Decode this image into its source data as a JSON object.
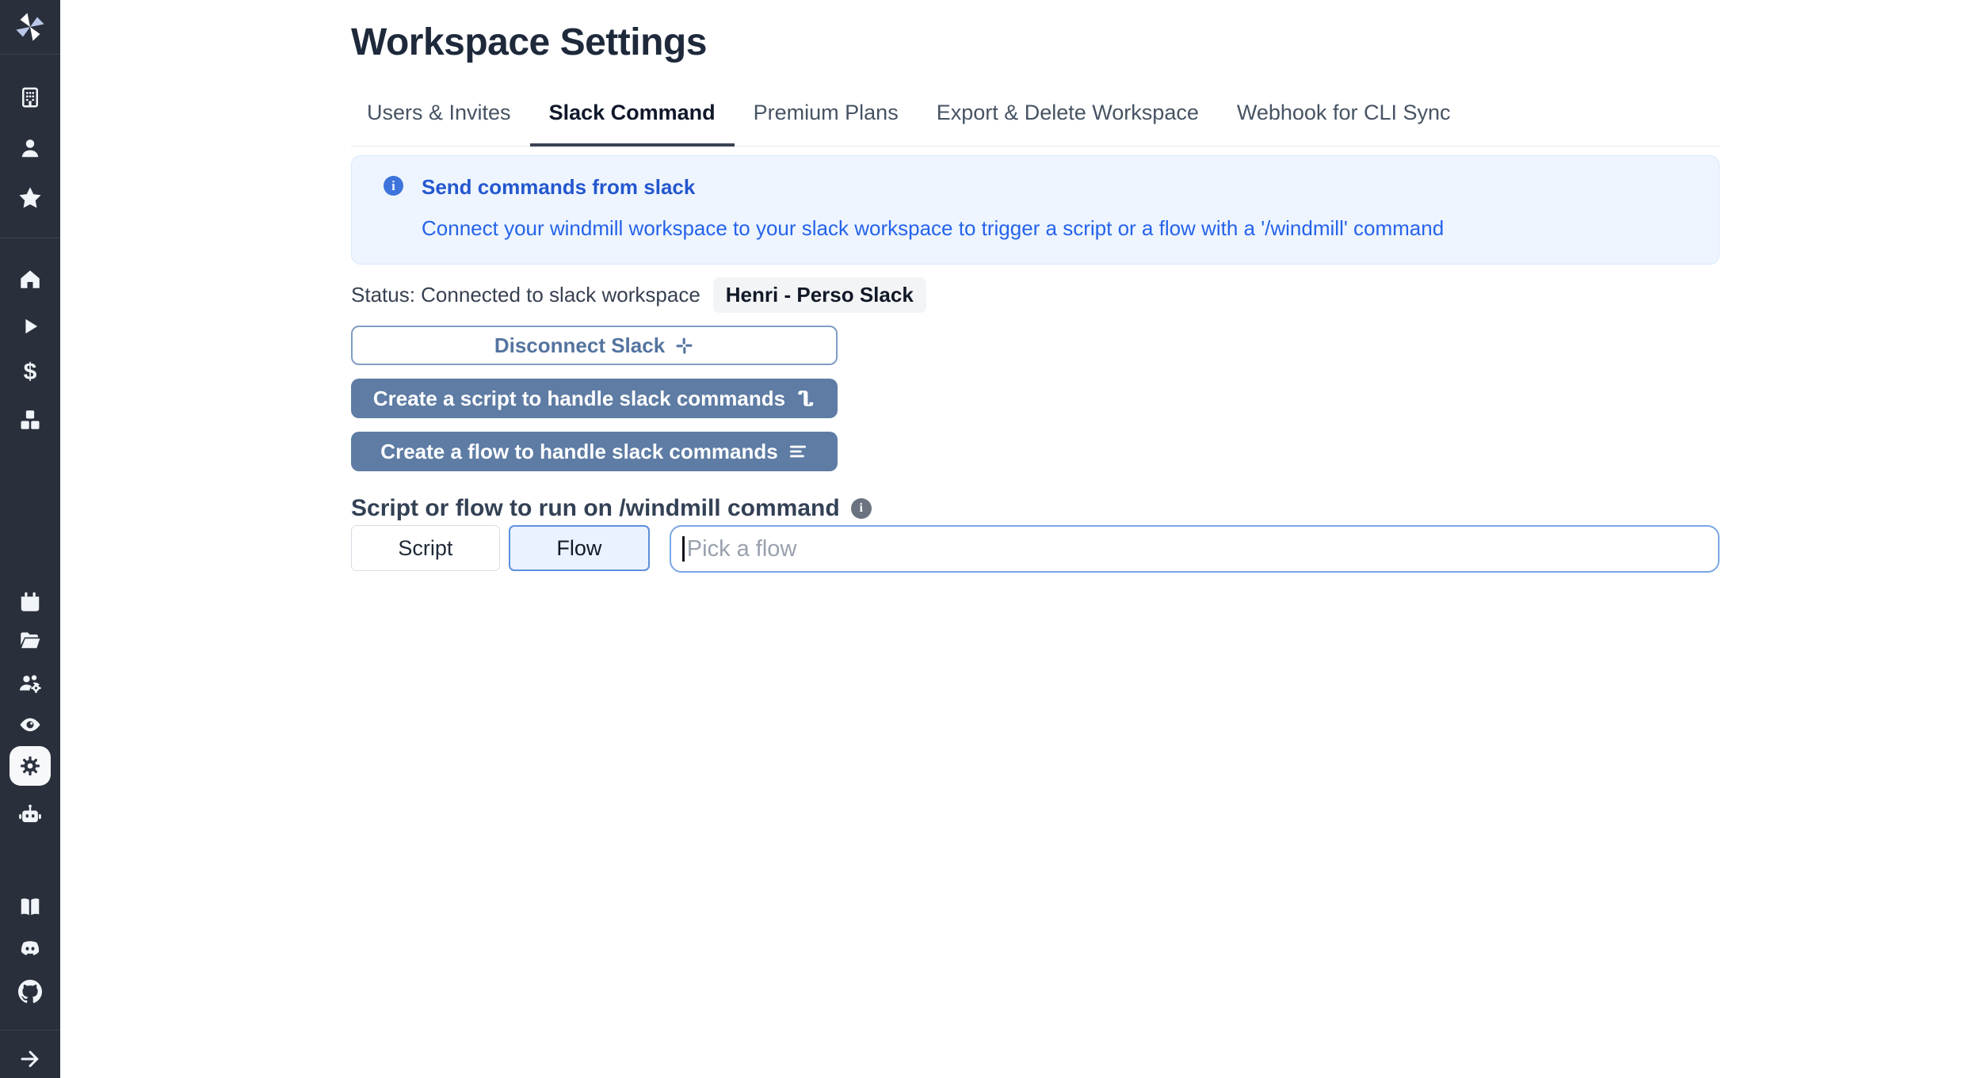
{
  "page": {
    "title": "Workspace Settings"
  },
  "tabs": [
    {
      "label": "Users & Invites"
    },
    {
      "label": "Slack Command"
    },
    {
      "label": "Premium Plans"
    },
    {
      "label": "Export & Delete Workspace"
    },
    {
      "label": "Webhook for CLI Sync"
    }
  ],
  "banner": {
    "title": "Send commands from slack",
    "body": "Connect your windmill workspace to your slack workspace to trigger a script or a flow with a '/windmill' command"
  },
  "status": {
    "label": "Status: Connected to slack workspace",
    "badge": "Henri - Perso Slack"
  },
  "buttons": {
    "disconnect": "Disconnect Slack",
    "create_script": "Create a script to handle slack commands",
    "create_flow": "Create a flow to handle slack commands"
  },
  "picker": {
    "heading": "Script or flow to run on /windmill command",
    "script": "Script",
    "flow": "Flow",
    "placeholder": "Pick a flow"
  },
  "sidebar": {
    "icons": [
      "windmill-logo",
      "workspace-building",
      "user",
      "favorites-star",
      "home",
      "runs-play",
      "variables-dollar",
      "resources-boxes",
      "schedules-calendar",
      "folders",
      "groups-users",
      "audit-eye",
      "settings-gear",
      "workers-robot",
      "docs-book",
      "discord",
      "github",
      "collapse-arrow"
    ]
  },
  "colors": {
    "sidebar_bg": "#292f3b",
    "accent_blue": "#2563eb",
    "banner_bg": "#eef5fe",
    "primary_button": "#5e7ca4",
    "outline_button_text": "#54749f",
    "active_tab_underline": "#394352",
    "flow_toggle_border": "#5e8fdf",
    "input_border": "#7aa7e6",
    "badge_bg": "#f3f4f6"
  }
}
